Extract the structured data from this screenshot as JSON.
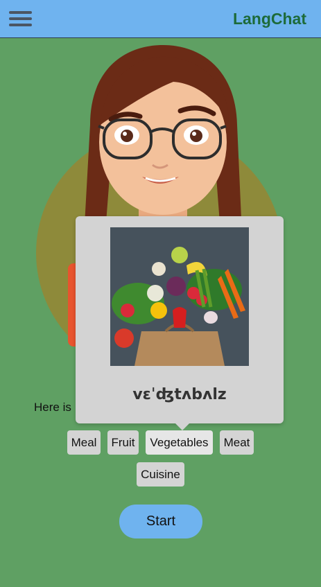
{
  "app": {
    "brand": "LangChat",
    "menu_icon": "hamburger-icon",
    "colors": {
      "header": "#6fb3ef",
      "background": "#5fa063",
      "brand_text": "#1d6b3a",
      "chip": "#d4d4d4",
      "popover": "#d3d3d3"
    }
  },
  "intro": {
    "lead": "Here is",
    "trail": ":"
  },
  "topics": [
    "Meal",
    "Fruit",
    "Vegetables",
    "Meat",
    "Cuisine"
  ],
  "selected_topic": "Vegetables",
  "popover": {
    "pronunciation": "vɛˈʤtʌbʌlz",
    "image": "vegetables-in-paper-bag"
  },
  "start_label": "Start"
}
